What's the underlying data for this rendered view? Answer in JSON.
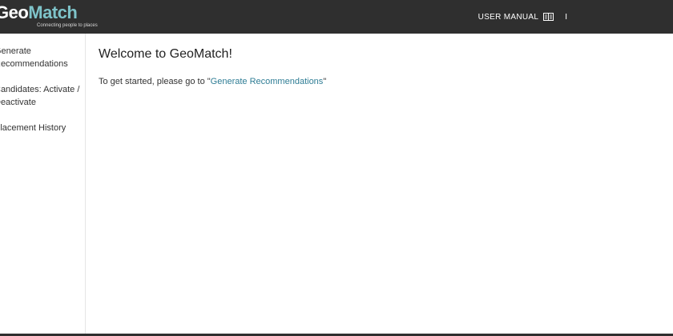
{
  "header": {
    "logo": {
      "part1": "Geo",
      "part2": "Match",
      "tagline": "Connecting people to places"
    },
    "user_manual_label": "USER MANUAL",
    "manual_icon": "book-icon",
    "separator": "I"
  },
  "sidebar": {
    "items": [
      {
        "label": "Generate Recommendations"
      },
      {
        "label": "Candidates: Activate / Deactivate"
      },
      {
        "label": "Placement History"
      }
    ]
  },
  "main": {
    "title": "Welcome to GeoMatch!",
    "intro_prefix": "To get started, please go to \"",
    "intro_link": "Generate Recommendations",
    "intro_suffix": "\""
  },
  "colors": {
    "topbar": "#2f2f2f",
    "logo_accent": "#7ec3c9",
    "link": "#2f7d95"
  }
}
